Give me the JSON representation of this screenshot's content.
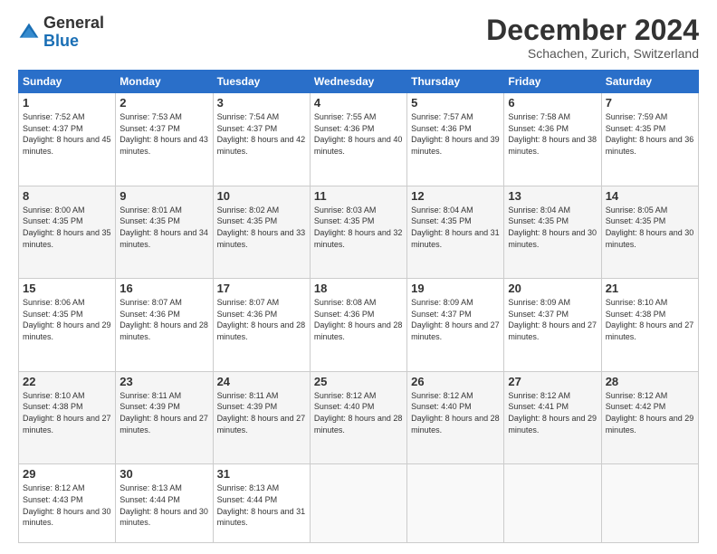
{
  "logo": {
    "general": "General",
    "blue": "Blue"
  },
  "header": {
    "month": "December 2024",
    "location": "Schachen, Zurich, Switzerland"
  },
  "weekdays": [
    "Sunday",
    "Monday",
    "Tuesday",
    "Wednesday",
    "Thursday",
    "Friday",
    "Saturday"
  ],
  "weeks": [
    [
      {
        "day": "1",
        "sunrise": "7:52 AM",
        "sunset": "4:37 PM",
        "daylight": "8 hours and 45 minutes."
      },
      {
        "day": "2",
        "sunrise": "7:53 AM",
        "sunset": "4:37 PM",
        "daylight": "8 hours and 43 minutes."
      },
      {
        "day": "3",
        "sunrise": "7:54 AM",
        "sunset": "4:37 PM",
        "daylight": "8 hours and 42 minutes."
      },
      {
        "day": "4",
        "sunrise": "7:55 AM",
        "sunset": "4:36 PM",
        "daylight": "8 hours and 40 minutes."
      },
      {
        "day": "5",
        "sunrise": "7:57 AM",
        "sunset": "4:36 PM",
        "daylight": "8 hours and 39 minutes."
      },
      {
        "day": "6",
        "sunrise": "7:58 AM",
        "sunset": "4:36 PM",
        "daylight": "8 hours and 38 minutes."
      },
      {
        "day": "7",
        "sunrise": "7:59 AM",
        "sunset": "4:35 PM",
        "daylight": "8 hours and 36 minutes."
      }
    ],
    [
      {
        "day": "8",
        "sunrise": "8:00 AM",
        "sunset": "4:35 PM",
        "daylight": "8 hours and 35 minutes."
      },
      {
        "day": "9",
        "sunrise": "8:01 AM",
        "sunset": "4:35 PM",
        "daylight": "8 hours and 34 minutes."
      },
      {
        "day": "10",
        "sunrise": "8:02 AM",
        "sunset": "4:35 PM",
        "daylight": "8 hours and 33 minutes."
      },
      {
        "day": "11",
        "sunrise": "8:03 AM",
        "sunset": "4:35 PM",
        "daylight": "8 hours and 32 minutes."
      },
      {
        "day": "12",
        "sunrise": "8:04 AM",
        "sunset": "4:35 PM",
        "daylight": "8 hours and 31 minutes."
      },
      {
        "day": "13",
        "sunrise": "8:04 AM",
        "sunset": "4:35 PM",
        "daylight": "8 hours and 30 minutes."
      },
      {
        "day": "14",
        "sunrise": "8:05 AM",
        "sunset": "4:35 PM",
        "daylight": "8 hours and 30 minutes."
      }
    ],
    [
      {
        "day": "15",
        "sunrise": "8:06 AM",
        "sunset": "4:35 PM",
        "daylight": "8 hours and 29 minutes."
      },
      {
        "day": "16",
        "sunrise": "8:07 AM",
        "sunset": "4:36 PM",
        "daylight": "8 hours and 28 minutes."
      },
      {
        "day": "17",
        "sunrise": "8:07 AM",
        "sunset": "4:36 PM",
        "daylight": "8 hours and 28 minutes."
      },
      {
        "day": "18",
        "sunrise": "8:08 AM",
        "sunset": "4:36 PM",
        "daylight": "8 hours and 28 minutes."
      },
      {
        "day": "19",
        "sunrise": "8:09 AM",
        "sunset": "4:37 PM",
        "daylight": "8 hours and 27 minutes."
      },
      {
        "day": "20",
        "sunrise": "8:09 AM",
        "sunset": "4:37 PM",
        "daylight": "8 hours and 27 minutes."
      },
      {
        "day": "21",
        "sunrise": "8:10 AM",
        "sunset": "4:38 PM",
        "daylight": "8 hours and 27 minutes."
      }
    ],
    [
      {
        "day": "22",
        "sunrise": "8:10 AM",
        "sunset": "4:38 PM",
        "daylight": "8 hours and 27 minutes."
      },
      {
        "day": "23",
        "sunrise": "8:11 AM",
        "sunset": "4:39 PM",
        "daylight": "8 hours and 27 minutes."
      },
      {
        "day": "24",
        "sunrise": "8:11 AM",
        "sunset": "4:39 PM",
        "daylight": "8 hours and 27 minutes."
      },
      {
        "day": "25",
        "sunrise": "8:12 AM",
        "sunset": "4:40 PM",
        "daylight": "8 hours and 28 minutes."
      },
      {
        "day": "26",
        "sunrise": "8:12 AM",
        "sunset": "4:40 PM",
        "daylight": "8 hours and 28 minutes."
      },
      {
        "day": "27",
        "sunrise": "8:12 AM",
        "sunset": "4:41 PM",
        "daylight": "8 hours and 29 minutes."
      },
      {
        "day": "28",
        "sunrise": "8:12 AM",
        "sunset": "4:42 PM",
        "daylight": "8 hours and 29 minutes."
      }
    ],
    [
      {
        "day": "29",
        "sunrise": "8:12 AM",
        "sunset": "4:43 PM",
        "daylight": "8 hours and 30 minutes."
      },
      {
        "day": "30",
        "sunrise": "8:13 AM",
        "sunset": "4:44 PM",
        "daylight": "8 hours and 30 minutes."
      },
      {
        "day": "31",
        "sunrise": "8:13 AM",
        "sunset": "4:44 PM",
        "daylight": "8 hours and 31 minutes."
      },
      null,
      null,
      null,
      null
    ]
  ],
  "labels": {
    "sunrise": "Sunrise:",
    "sunset": "Sunset:",
    "daylight": "Daylight:"
  }
}
